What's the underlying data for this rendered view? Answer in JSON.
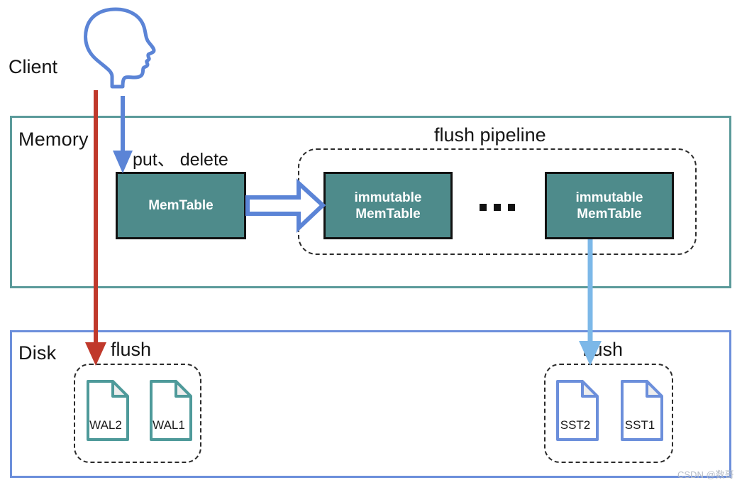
{
  "diagram": {
    "client": {
      "label": "Client",
      "icon": "head-profile-icon"
    },
    "memory": {
      "label": "Memory",
      "border_color": "#5b9a9a",
      "memtable": {
        "label": "MemTable"
      },
      "flush_pipeline": {
        "label": "flush pipeline",
        "ellipsis": "■ ■ ■",
        "immutable_memtables": [
          {
            "label": "immutable\nMemTable"
          },
          {
            "label": "immutable\nMemTable"
          }
        ]
      },
      "operations_label": "put、 delete"
    },
    "disk": {
      "label": "Disk",
      "border_color": "#6c8fdb",
      "wal_group": {
        "flush_label": "flush",
        "files": [
          {
            "name": "WAL2",
            "color": "#4e9a9a"
          },
          {
            "name": "WAL1",
            "color": "#4e9a9a"
          }
        ]
      },
      "sst_group": {
        "flush_label": "flush",
        "files": [
          {
            "name": "SST2",
            "color": "#6c8fdb"
          },
          {
            "name": "SST1",
            "color": "#6c8fdb"
          }
        ]
      }
    },
    "arrows": {
      "client_to_wal": {
        "name": "wal-write-arrow",
        "color": "#c0392b"
      },
      "client_to_memtable": {
        "name": "put-delete-arrow",
        "color": "#5b84d6"
      },
      "memtable_to_immutable": {
        "name": "freeze-arrow",
        "color": "#5b84d6"
      },
      "immutable_to_sst": {
        "name": "flush-to-sst-arrow",
        "color": "#7cb8e8"
      }
    },
    "watermark": "CSDN @数哥"
  }
}
